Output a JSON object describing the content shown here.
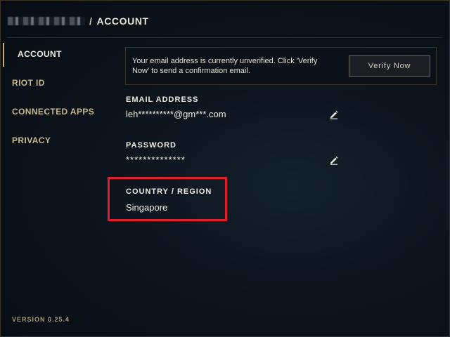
{
  "header": {
    "separator": "/",
    "title": "ACCOUNT"
  },
  "sidebar": {
    "items": [
      {
        "label": "ACCOUNT",
        "active": true
      },
      {
        "label": "RIOT ID"
      },
      {
        "label": "CONNECTED APPS"
      },
      {
        "label": "PRIVACY"
      }
    ],
    "version": "VERSION 0.25.4"
  },
  "notice": {
    "text": "Your email address is currently unverified. Click 'Verify Now' to send a confirmation email.",
    "button_label": "Verify Now"
  },
  "email": {
    "label": "EMAIL ADDRESS",
    "value": "leh**********@gm***.com"
  },
  "password": {
    "label": "PASSWORD",
    "value": "**************"
  },
  "country": {
    "label": "COUNTRY / REGION",
    "value": "Singapore"
  },
  "colors": {
    "accent": "#c8aa6e",
    "highlight": "#e0202a",
    "background": "#0a1018"
  }
}
